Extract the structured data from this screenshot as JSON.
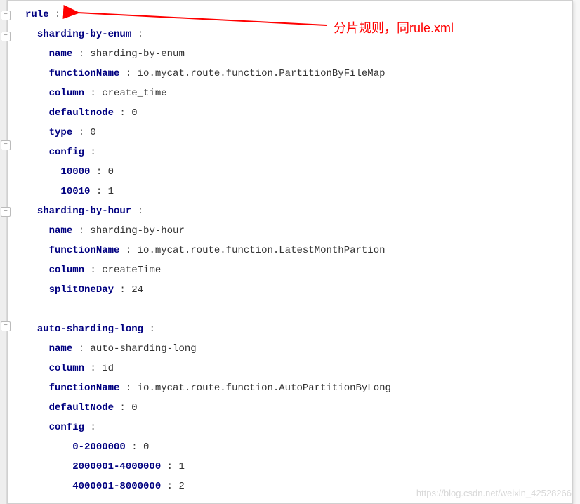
{
  "annotation": "分片规则，同rule.xml",
  "watermark": "https://blog.csdn.net/weixin_42528266",
  "lines": [
    {
      "indent": 0,
      "key": "rule",
      "val": ""
    },
    {
      "indent": 1,
      "key": "sharding-by-enum",
      "val": ""
    },
    {
      "indent": 2,
      "key": "name",
      "val": "sharding-by-enum"
    },
    {
      "indent": 2,
      "key": "functionName",
      "val": "io.mycat.route.function.PartitionByFileMap"
    },
    {
      "indent": 2,
      "key": "column",
      "val": "create_time"
    },
    {
      "indent": 2,
      "key": "defaultnode",
      "val": "0"
    },
    {
      "indent": 2,
      "key": "type",
      "val": "0"
    },
    {
      "indent": 2,
      "key": "config",
      "val": ""
    },
    {
      "indent": 3,
      "key": "10000",
      "val": "0"
    },
    {
      "indent": 3,
      "key": "10010",
      "val": "1"
    },
    {
      "indent": 1,
      "key": "sharding-by-hour",
      "val": ""
    },
    {
      "indent": 2,
      "key": "name",
      "val": "sharding-by-hour"
    },
    {
      "indent": 2,
      "key": "functionName",
      "val": "io.mycat.route.function.LatestMonthPartion"
    },
    {
      "indent": 2,
      "key": "column",
      "val": "createTime"
    },
    {
      "indent": 2,
      "key": "splitOneDay",
      "val": "24"
    },
    {
      "blank": true
    },
    {
      "indent": 1,
      "key": "auto-sharding-long",
      "val": ""
    },
    {
      "indent": 2,
      "key": "name",
      "val": "auto-sharding-long"
    },
    {
      "indent": 2,
      "key": "column",
      "val": "id"
    },
    {
      "indent": 2,
      "key": "functionName",
      "val": "io.mycat.route.function.AutoPartitionByLong"
    },
    {
      "indent": 2,
      "key": "defaultNode",
      "val": "0"
    },
    {
      "indent": 2,
      "key": "config",
      "val": ""
    },
    {
      "indent": 4,
      "key": "0-2000000",
      "val": "0"
    },
    {
      "indent": 4,
      "key": "2000001-4000000",
      "val": "1"
    },
    {
      "indent": 4,
      "key": "4000001-8000000",
      "val": "2"
    }
  ],
  "folds": [
    15,
    45,
    200,
    295,
    458
  ]
}
